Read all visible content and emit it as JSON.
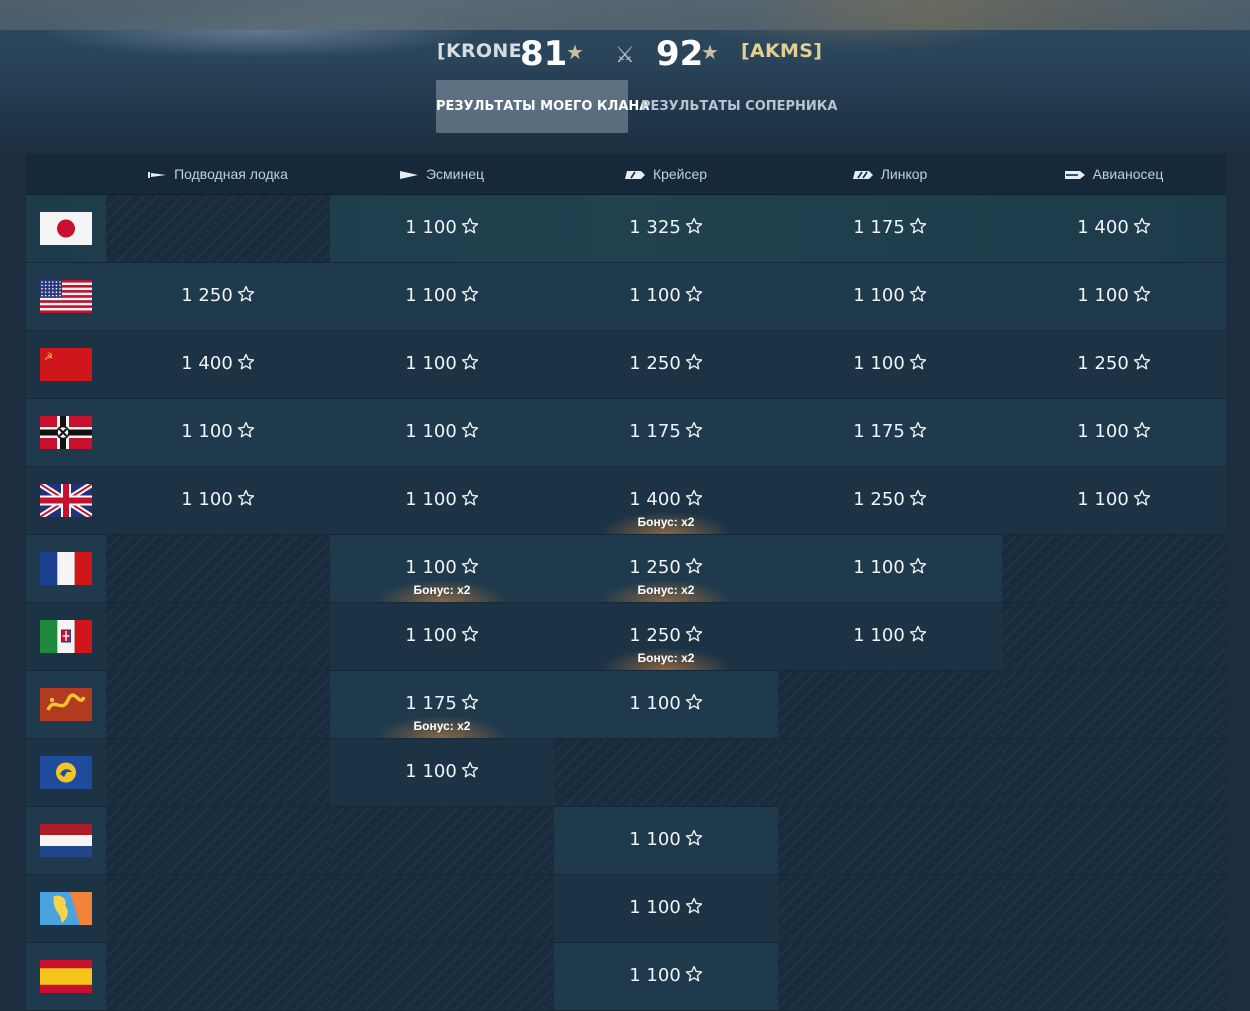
{
  "header": {
    "own_clan": "[KRONE]",
    "own_score": "81",
    "enemy_score": "92",
    "enemy_clan": "[AKMS]",
    "star_icon": "star-icon",
    "versus_icon": "crossed-swords-icon"
  },
  "tabs": [
    {
      "label": "Результаты моего клана",
      "active": true
    },
    {
      "label": "Результаты соперника",
      "active": false
    }
  ],
  "columns": [
    {
      "label": "Подводная лодка",
      "icon": "submarine-class-icon"
    },
    {
      "label": "Эсминец",
      "icon": "destroyer-class-icon"
    },
    {
      "label": "Крейсер",
      "icon": "cruiser-class-icon"
    },
    {
      "label": "Линкор",
      "icon": "battleship-class-icon"
    },
    {
      "label": "Авианосец",
      "icon": "aircraft-carrier-class-icon"
    }
  ],
  "bonus_label": "Бонус: x2",
  "rows": [
    {
      "nation_flag": "japan-flag-icon",
      "cells": [
        null,
        {
          "value": "1 100"
        },
        {
          "value": "1 325"
        },
        {
          "value": "1 175"
        },
        {
          "value": "1 400"
        }
      ]
    },
    {
      "nation_flag": "usa-flag-icon",
      "cells": [
        {
          "value": "1 250"
        },
        {
          "value": "1 100"
        },
        {
          "value": "1 100"
        },
        {
          "value": "1 100"
        },
        {
          "value": "1 100"
        }
      ]
    },
    {
      "nation_flag": "ussr-flag-icon",
      "cells": [
        {
          "value": "1 400"
        },
        {
          "value": "1 100"
        },
        {
          "value": "1 250"
        },
        {
          "value": "1 100"
        },
        {
          "value": "1 250"
        }
      ]
    },
    {
      "nation_flag": "germany-flag-icon",
      "cells": [
        {
          "value": "1 100"
        },
        {
          "value": "1 100"
        },
        {
          "value": "1 175"
        },
        {
          "value": "1 175"
        },
        {
          "value": "1 100"
        }
      ]
    },
    {
      "nation_flag": "uk-flag-icon",
      "cells": [
        {
          "value": "1 100"
        },
        {
          "value": "1 100"
        },
        {
          "value": "1 400",
          "bonus": true
        },
        {
          "value": "1 250"
        },
        {
          "value": "1 100"
        }
      ]
    },
    {
      "nation_flag": "france-flag-icon",
      "cells": [
        null,
        {
          "value": "1 100",
          "bonus": true
        },
        {
          "value": "1 250",
          "bonus": true
        },
        {
          "value": "1 100"
        },
        null
      ]
    },
    {
      "nation_flag": "italy-flag-icon",
      "cells": [
        null,
        {
          "value": "1 100"
        },
        {
          "value": "1 250",
          "bonus": true
        },
        {
          "value": "1 100"
        },
        null
      ]
    },
    {
      "nation_flag": "pan-asia-flag-icon",
      "cells": [
        null,
        {
          "value": "1 175",
          "bonus": true
        },
        {
          "value": "1 100"
        },
        null,
        null
      ]
    },
    {
      "nation_flag": "commonwealth-flag-icon",
      "cells": [
        null,
        {
          "value": "1 100"
        },
        null,
        null,
        null
      ]
    },
    {
      "nation_flag": "netherlands-flag-icon",
      "cells": [
        null,
        null,
        {
          "value": "1 100"
        },
        null,
        null
      ]
    },
    {
      "nation_flag": "pan-america-flag-icon",
      "cells": [
        null,
        null,
        {
          "value": "1 100"
        },
        null,
        null
      ]
    },
    {
      "nation_flag": "spain-flag-icon",
      "cells": [
        null,
        null,
        {
          "value": "1 100"
        },
        null,
        null
      ]
    }
  ]
}
